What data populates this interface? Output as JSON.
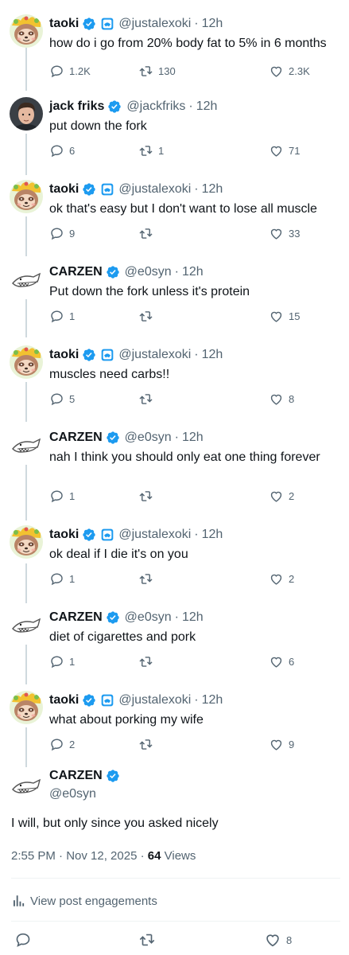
{
  "colors": {
    "verified": "#1d9bf0",
    "muted": "#536471",
    "text": "#0f1419",
    "thread_line": "#cfd9de"
  },
  "icons": {
    "reply": "reply-icon",
    "retweet": "retweet-icon",
    "like": "heart-icon",
    "verified": "verified-badge-icon",
    "affiliate": "affiliate-badge-icon",
    "engagements": "bar-chart-icon"
  },
  "tweets": [
    {
      "name": "taoki",
      "handle": "@justalexoki",
      "time": "12h",
      "text": "how do i go from 20% body fat to 5% in 6 months",
      "replies": "1.2K",
      "retweets": "130",
      "likes": "2.3K",
      "affiliate": true,
      "avatar": "sloth"
    },
    {
      "name": "jack friks",
      "handle": "@jackfriks",
      "time": "12h",
      "text": "put down the fork",
      "replies": "6",
      "retweets": "1",
      "likes": "71",
      "affiliate": false,
      "avatar": "person"
    },
    {
      "name": "taoki",
      "handle": "@justalexoki",
      "time": "12h",
      "text": "ok that's easy but I don't want to lose all muscle",
      "replies": "9",
      "retweets": "",
      "likes": "33",
      "affiliate": true,
      "avatar": "sloth"
    },
    {
      "name": "CARZEN",
      "handle": "@e0syn",
      "time": "12h",
      "text": "Put down the fork unless it's protein",
      "replies": "1",
      "retweets": "",
      "likes": "15",
      "affiliate": false,
      "avatar": "shark"
    },
    {
      "name": "taoki",
      "handle": "@justalexoki",
      "time": "12h",
      "text": "muscles need carbs!!",
      "replies": "5",
      "retweets": "",
      "likes": "8",
      "affiliate": true,
      "avatar": "sloth"
    },
    {
      "name": "CARZEN",
      "handle": "@e0syn",
      "time": "12h",
      "text": "nah I think you should only eat one thing forever",
      "replies": "1",
      "retweets": "",
      "likes": "2",
      "affiliate": false,
      "avatar": "shark"
    },
    {
      "name": "taoki",
      "handle": "@justalexoki",
      "time": "12h",
      "text": "ok deal if I die it's on you",
      "replies": "1",
      "retweets": "",
      "likes": "2",
      "affiliate": true,
      "avatar": "sloth"
    },
    {
      "name": "CARZEN",
      "handle": "@e0syn",
      "time": "12h",
      "text": "diet of cigarettes and pork",
      "replies": "1",
      "retweets": "",
      "likes": "6",
      "affiliate": false,
      "avatar": "shark"
    },
    {
      "name": "taoki",
      "handle": "@justalexoki",
      "time": "12h",
      "text": "what about porking my wife",
      "replies": "2",
      "retweets": "",
      "likes": "9",
      "affiliate": true,
      "avatar": "sloth"
    }
  ],
  "main_tweet": {
    "name": "CARZEN",
    "handle": "@e0syn",
    "text": "I will, but only since you asked nicely",
    "timestamp": "2:55 PM · Nov 12, 2025",
    "separator": "·",
    "views_count": "64",
    "views_label": "Views",
    "engagements_label": "View post engagements",
    "replies": "",
    "retweets": "",
    "likes": "8"
  }
}
